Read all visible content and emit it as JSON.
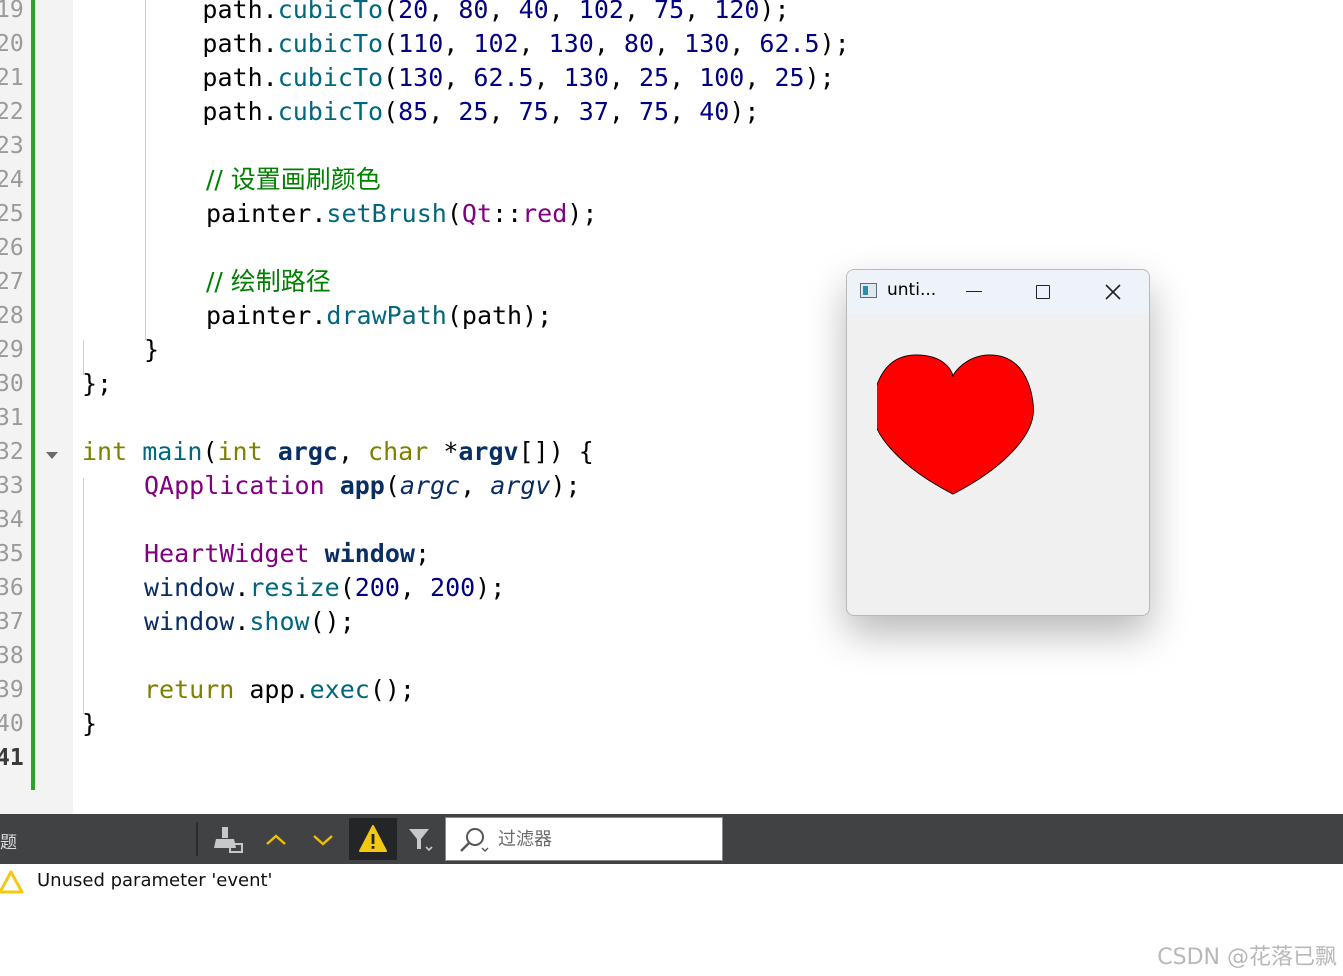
{
  "editor": {
    "line_numbers": [
      "19",
      "20",
      "21",
      "22",
      "23",
      "24",
      "25",
      "26",
      "27",
      "28",
      "29",
      "30",
      "31",
      "32",
      "33",
      "34",
      "35",
      "36",
      "37",
      "38",
      "39",
      "40",
      "41"
    ],
    "current_line": "41",
    "code": {
      "l19": {
        "indent": "        ",
        "obj": "path",
        "dot": ".",
        "fn": "cubicTo",
        "open": "(",
        "a": "20",
        "s1": ", ",
        "b": "80",
        "s2": ", ",
        "c": "40",
        "s3": ", ",
        "d": "102",
        "s4": ", ",
        "e": "75",
        "s5": ", ",
        "f": "120",
        "close": ");"
      },
      "l20": {
        "indent": "        ",
        "obj": "path",
        "dot": ".",
        "fn": "cubicTo",
        "open": "(",
        "a": "110",
        "s1": ", ",
        "b": "102",
        "s2": ", ",
        "c": "130",
        "s3": ", ",
        "d": "80",
        "s4": ", ",
        "e": "130",
        "s5": ", ",
        "f": "62.5",
        "close": ");"
      },
      "l21": {
        "indent": "        ",
        "obj": "path",
        "dot": ".",
        "fn": "cubicTo",
        "open": "(",
        "a": "130",
        "s1": ", ",
        "b": "62.5",
        "s2": ", ",
        "c": "130",
        "s3": ", ",
        "d": "25",
        "s4": ", ",
        "e": "100",
        "s5": ", ",
        "f": "25",
        "close": ");"
      },
      "l22": {
        "indent": "        ",
        "obj": "path",
        "dot": ".",
        "fn": "cubicTo",
        "open": "(",
        "a": "85",
        "s1": ", ",
        "b": "25",
        "s2": ", ",
        "c": "75",
        "s3": ", ",
        "d": "37",
        "s4": ", ",
        "e": "75",
        "s5": ", ",
        "f": "40",
        "close": ");"
      },
      "l24": {
        "comment": "// 设置画刷颜色"
      },
      "l25": {
        "obj": "painter",
        "dot": ".",
        "fn": "setBrush",
        "open": "(",
        "ns": "Qt",
        "sep": "::",
        "val": "red",
        "close": ");"
      },
      "l27": {
        "comment": "// 绘制路径"
      },
      "l28": {
        "obj": "painter",
        "dot": ".",
        "fn": "drawPath",
        "open": "(",
        "arg": "path",
        "close": ");"
      },
      "l29": {
        "text": "}"
      },
      "l30": {
        "text": "};"
      },
      "l32": {
        "kw1": "int",
        "sp1": " ",
        "fn": "main",
        "open": "(",
        "kw2": "int",
        "sp2": " ",
        "arg1": "argc",
        "comma": ", ",
        "kw3": "char",
        "sp3": " *",
        "arg2": "argv",
        "rest": "[]) {"
      },
      "l33": {
        "type": "QApplication",
        "sp": " ",
        "var": "app",
        "open": "(",
        "a1": "argc",
        "comma": ", ",
        "a2": "argv",
        "close": ");"
      },
      "l35": {
        "type": "HeartWidget",
        "sp": " ",
        "var": "window",
        "semi": ";"
      },
      "l36": {
        "obj": "window",
        "dot": ".",
        "fn": "resize",
        "open": "(",
        "a": "200",
        "comma": ", ",
        "b": "200",
        "close": ");"
      },
      "l37": {
        "obj": "window",
        "dot": ".",
        "fn": "show",
        "rest": "();"
      },
      "l39": {
        "kw": "return",
        "sp": " ",
        "obj": "app",
        "dot": ".",
        "fn": "exec",
        "rest": "();"
      },
      "l40": {
        "text": "}"
      }
    }
  },
  "window": {
    "title": "unti...",
    "heart_color": "#ff0000",
    "background": "#f0f0f0"
  },
  "issues": {
    "panel_label_partial": "题",
    "filter_placeholder": "过滤器",
    "items": [
      {
        "severity": "warning",
        "text": "Unused parameter 'event'"
      }
    ]
  },
  "watermark": "CSDN @花落已飘",
  "colors": {
    "keyword": "#808000",
    "function": "#00677c",
    "number": "#000080",
    "type": "#800080",
    "comment": "#008000",
    "toolbar": "#404244",
    "change_bar": "#2ea02e",
    "warning": "#f2c811"
  }
}
